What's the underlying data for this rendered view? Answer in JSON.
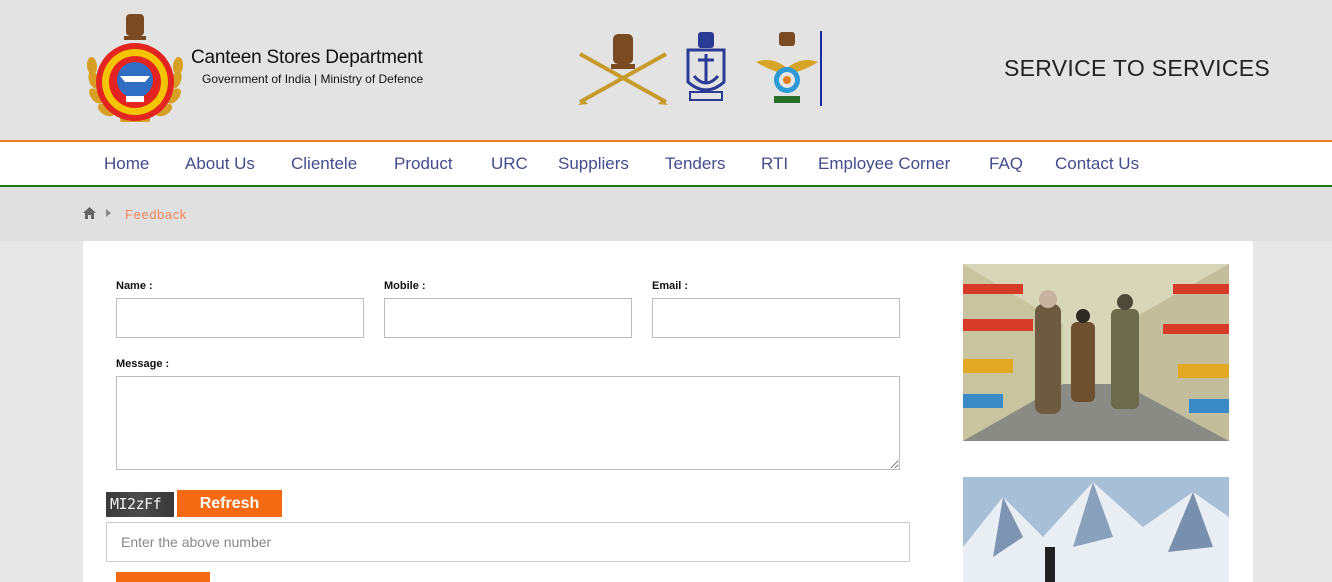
{
  "header": {
    "brand_title": "Canteen Stores Department",
    "brand_subtitle": "Government of India | Ministry of Defence",
    "tagline": "SERVICE TO SERVICES"
  },
  "nav": {
    "items": [
      {
        "label": "Home"
      },
      {
        "label": "About Us"
      },
      {
        "label": "Clientele"
      },
      {
        "label": "Product"
      },
      {
        "label": "URC"
      },
      {
        "label": "Suppliers"
      },
      {
        "label": "Tenders"
      },
      {
        "label": "RTI"
      },
      {
        "label": "Employee Corner"
      },
      {
        "label": "FAQ"
      },
      {
        "label": "Contact Us"
      }
    ]
  },
  "breadcrumb": {
    "current": "Feedback"
  },
  "form": {
    "name_label": "Name :",
    "mobile_label": "Mobile :",
    "email_label": "Email :",
    "message_label": "Message :",
    "captcha_text": "MI2zFf",
    "refresh_label": "Refresh",
    "captcha_placeholder": "Enter the above number"
  },
  "colors": {
    "accent_orange": "#f46a12",
    "nav_text": "#434c8c",
    "nav_top_border": "#f07a1a",
    "nav_bottom_border": "#1c7a1c",
    "breadcrumb_current": "#f0845a"
  }
}
